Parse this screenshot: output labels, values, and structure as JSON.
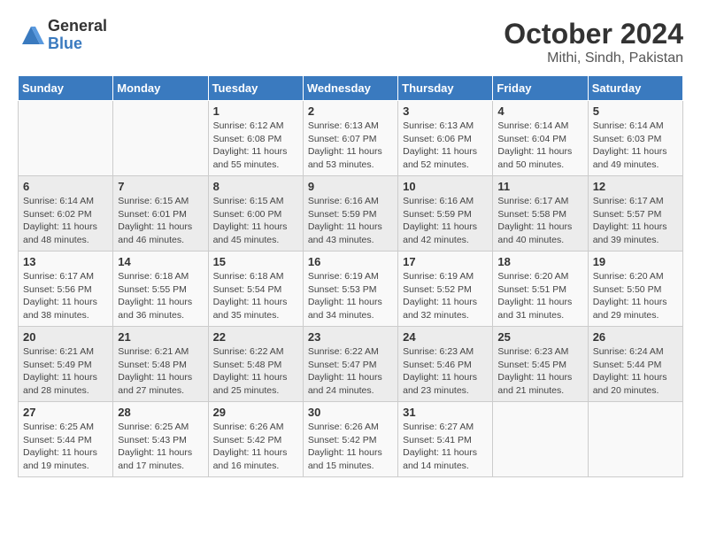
{
  "header": {
    "logo_general": "General",
    "logo_blue": "Blue",
    "month_title": "October 2024",
    "location": "Mithi, Sindh, Pakistan"
  },
  "days_of_week": [
    "Sunday",
    "Monday",
    "Tuesday",
    "Wednesday",
    "Thursday",
    "Friday",
    "Saturday"
  ],
  "weeks": [
    [
      {
        "day": "",
        "info": ""
      },
      {
        "day": "",
        "info": ""
      },
      {
        "day": "1",
        "info": "Sunrise: 6:12 AM\nSunset: 6:08 PM\nDaylight: 11 hours and 55 minutes."
      },
      {
        "day": "2",
        "info": "Sunrise: 6:13 AM\nSunset: 6:07 PM\nDaylight: 11 hours and 53 minutes."
      },
      {
        "day": "3",
        "info": "Sunrise: 6:13 AM\nSunset: 6:06 PM\nDaylight: 11 hours and 52 minutes."
      },
      {
        "day": "4",
        "info": "Sunrise: 6:14 AM\nSunset: 6:04 PM\nDaylight: 11 hours and 50 minutes."
      },
      {
        "day": "5",
        "info": "Sunrise: 6:14 AM\nSunset: 6:03 PM\nDaylight: 11 hours and 49 minutes."
      }
    ],
    [
      {
        "day": "6",
        "info": "Sunrise: 6:14 AM\nSunset: 6:02 PM\nDaylight: 11 hours and 48 minutes."
      },
      {
        "day": "7",
        "info": "Sunrise: 6:15 AM\nSunset: 6:01 PM\nDaylight: 11 hours and 46 minutes."
      },
      {
        "day": "8",
        "info": "Sunrise: 6:15 AM\nSunset: 6:00 PM\nDaylight: 11 hours and 45 minutes."
      },
      {
        "day": "9",
        "info": "Sunrise: 6:16 AM\nSunset: 5:59 PM\nDaylight: 11 hours and 43 minutes."
      },
      {
        "day": "10",
        "info": "Sunrise: 6:16 AM\nSunset: 5:59 PM\nDaylight: 11 hours and 42 minutes."
      },
      {
        "day": "11",
        "info": "Sunrise: 6:17 AM\nSunset: 5:58 PM\nDaylight: 11 hours and 40 minutes."
      },
      {
        "day": "12",
        "info": "Sunrise: 6:17 AM\nSunset: 5:57 PM\nDaylight: 11 hours and 39 minutes."
      }
    ],
    [
      {
        "day": "13",
        "info": "Sunrise: 6:17 AM\nSunset: 5:56 PM\nDaylight: 11 hours and 38 minutes."
      },
      {
        "day": "14",
        "info": "Sunrise: 6:18 AM\nSunset: 5:55 PM\nDaylight: 11 hours and 36 minutes."
      },
      {
        "day": "15",
        "info": "Sunrise: 6:18 AM\nSunset: 5:54 PM\nDaylight: 11 hours and 35 minutes."
      },
      {
        "day": "16",
        "info": "Sunrise: 6:19 AM\nSunset: 5:53 PM\nDaylight: 11 hours and 34 minutes."
      },
      {
        "day": "17",
        "info": "Sunrise: 6:19 AM\nSunset: 5:52 PM\nDaylight: 11 hours and 32 minutes."
      },
      {
        "day": "18",
        "info": "Sunrise: 6:20 AM\nSunset: 5:51 PM\nDaylight: 11 hours and 31 minutes."
      },
      {
        "day": "19",
        "info": "Sunrise: 6:20 AM\nSunset: 5:50 PM\nDaylight: 11 hours and 29 minutes."
      }
    ],
    [
      {
        "day": "20",
        "info": "Sunrise: 6:21 AM\nSunset: 5:49 PM\nDaylight: 11 hours and 28 minutes."
      },
      {
        "day": "21",
        "info": "Sunrise: 6:21 AM\nSunset: 5:48 PM\nDaylight: 11 hours and 27 minutes."
      },
      {
        "day": "22",
        "info": "Sunrise: 6:22 AM\nSunset: 5:48 PM\nDaylight: 11 hours and 25 minutes."
      },
      {
        "day": "23",
        "info": "Sunrise: 6:22 AM\nSunset: 5:47 PM\nDaylight: 11 hours and 24 minutes."
      },
      {
        "day": "24",
        "info": "Sunrise: 6:23 AM\nSunset: 5:46 PM\nDaylight: 11 hours and 23 minutes."
      },
      {
        "day": "25",
        "info": "Sunrise: 6:23 AM\nSunset: 5:45 PM\nDaylight: 11 hours and 21 minutes."
      },
      {
        "day": "26",
        "info": "Sunrise: 6:24 AM\nSunset: 5:44 PM\nDaylight: 11 hours and 20 minutes."
      }
    ],
    [
      {
        "day": "27",
        "info": "Sunrise: 6:25 AM\nSunset: 5:44 PM\nDaylight: 11 hours and 19 minutes."
      },
      {
        "day": "28",
        "info": "Sunrise: 6:25 AM\nSunset: 5:43 PM\nDaylight: 11 hours and 17 minutes."
      },
      {
        "day": "29",
        "info": "Sunrise: 6:26 AM\nSunset: 5:42 PM\nDaylight: 11 hours and 16 minutes."
      },
      {
        "day": "30",
        "info": "Sunrise: 6:26 AM\nSunset: 5:42 PM\nDaylight: 11 hours and 15 minutes."
      },
      {
        "day": "31",
        "info": "Sunrise: 6:27 AM\nSunset: 5:41 PM\nDaylight: 11 hours and 14 minutes."
      },
      {
        "day": "",
        "info": ""
      },
      {
        "day": "",
        "info": ""
      }
    ]
  ]
}
